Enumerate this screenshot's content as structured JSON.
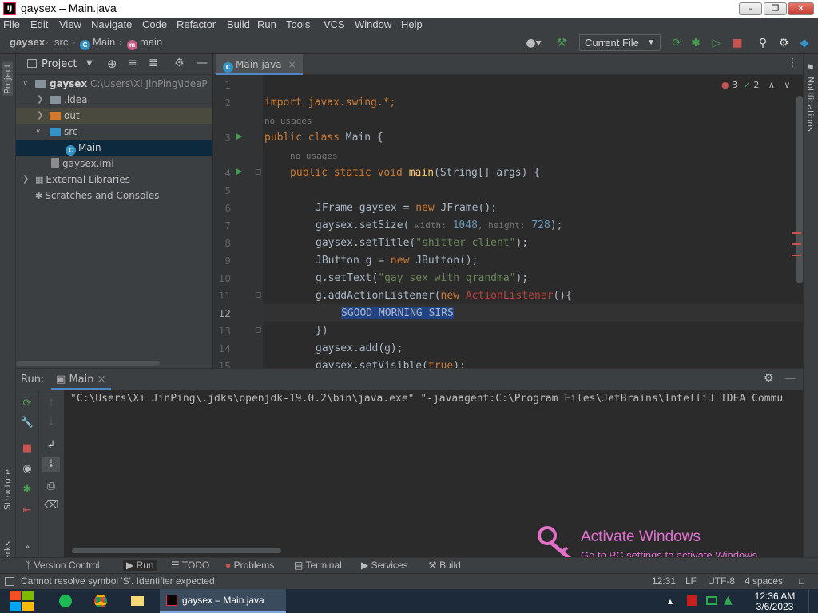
{
  "window": {
    "title": "gaysex – Main.java",
    "app_badge": "IJ"
  },
  "menu": [
    "File",
    "Edit",
    "View",
    "Navigate",
    "Code",
    "Refactor",
    "Build",
    "Run",
    "Tools",
    "VCS",
    "Window",
    "Help"
  ],
  "breadcrumb": {
    "project": "gaysex",
    "src": "src",
    "class": "Main",
    "method": "main"
  },
  "run_config": "Current File",
  "project_panel": {
    "title": "Project",
    "root": "gaysex",
    "root_path": "C:\\Users\\Xi JinPing\\IdeaP",
    "items": [
      {
        "label": ".idea"
      },
      {
        "label": "out"
      },
      {
        "label": "src"
      },
      {
        "label": "Main"
      },
      {
        "label": "gaysex.iml"
      },
      {
        "label": "External Libraries"
      },
      {
        "label": "Scratches and Consoles"
      }
    ]
  },
  "editor": {
    "tab": "Main.java",
    "errors": "3",
    "warnings": "2",
    "no_usages": "no usages",
    "line_numbers": [
      "1",
      "2",
      "",
      "3",
      "",
      "4",
      "5",
      "6",
      "7",
      "8",
      "9",
      "10",
      "11",
      "12",
      "13",
      "14",
      "15"
    ],
    "code": {
      "l2": "import javax.swing.*;",
      "l3a": "public class",
      "l3b": " Main {",
      "l4a": "public static void",
      "l4b": "main",
      "l4c": "(String[] args) {",
      "l6a": "JFrame gaysex = ",
      "l6b": "new",
      "l6c": " JFrame();",
      "l7a": "gaysex.setSize(",
      "l7p1": " width:",
      "l7n1": " 1048",
      "l7p2": ", height:",
      "l7n2": " 728",
      "l7c": ");",
      "l8a": "gaysex.setTitle(",
      "l8s": "\"shitter client\"",
      "l8c": ");",
      "l9a": "JButton g = ",
      "l9b": "new",
      "l9c": " JButton();",
      "l10a": "g.setText(",
      "l10s": "\"gay sex with grandma\"",
      "l10c": ");",
      "l11a": "g.addActionListener(",
      "l11b": "new",
      "l11c": "ActionListener",
      "l11d": "(){",
      "l12": "SGOOD MORNING SIRS",
      "l13": "})",
      "l14": "gaysex.add(g);",
      "l15a": "gaysex.setVisible(",
      "l15b": "true",
      "l15c": ");"
    }
  },
  "run_panel": {
    "label": "Run:",
    "tab": "Main",
    "console": "\"C:\\Users\\Xi JinPing\\.jdks\\openjdk-19.0.2\\bin\\java.exe\" \"-javaagent:C:\\Program Files\\JetBrains\\IntelliJ IDEA Commu"
  },
  "tool_windows": [
    "Version Control",
    "Run",
    "TODO",
    "Problems",
    "Terminal",
    "Services",
    "Build"
  ],
  "status": {
    "message": "Cannot resolve symbol 'S'. Identifier expected.",
    "position": "12:31",
    "line_sep": "LF",
    "encoding": "UTF-8",
    "indent": "4 spaces"
  },
  "side_labels": {
    "project": "Project",
    "structure": "Structure",
    "bookmarks": "Bookmarks",
    "notifications": "Notifications"
  },
  "watermark": {
    "title": "Activate Windows",
    "subtitle": "Go to PC settings to activate Windows."
  },
  "clock": {
    "time": "12:36 AM",
    "date": "3/6/2023"
  },
  "colors": {
    "accent": "#4a88c7",
    "keyword": "#cc7832",
    "string": "#6a8759",
    "run_green": "#499c54",
    "stop_red": "#c75450"
  }
}
